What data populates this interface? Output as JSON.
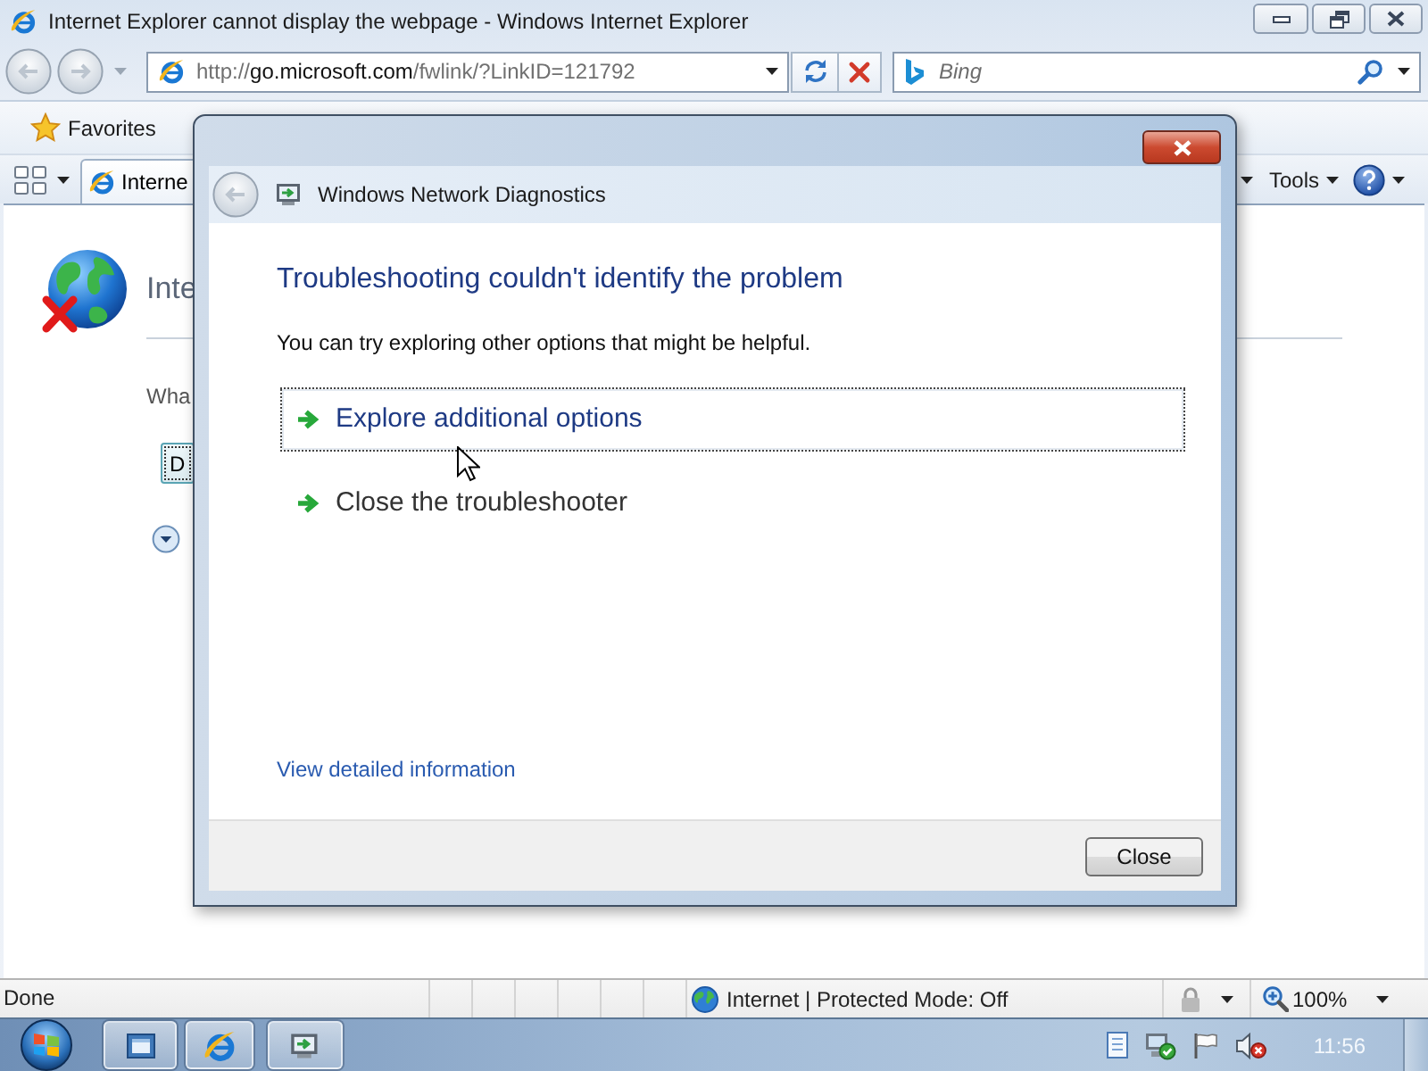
{
  "browser": {
    "title": "Internet Explorer cannot display the webpage - Windows Internet Explorer",
    "address": {
      "scheme": "http://",
      "domain": "go.microsoft.com",
      "path": "/fwlink/?LinkID=121792"
    },
    "search": {
      "placeholder": "Bing"
    }
  },
  "favorites_bar": {
    "label": "Favorites"
  },
  "command_bar": {
    "tabs": [
      {
        "label": "Interne",
        "selected": true
      }
    ],
    "menus": [
      {
        "label": "Tools"
      }
    ]
  },
  "page": {
    "heading": "Inte",
    "text": "Wha",
    "button": "D"
  },
  "dialog": {
    "title": "Windows Network Diagnostics",
    "heading": "Troubleshooting couldn't identify the problem",
    "message": "You can try exploring other options that might be helpful.",
    "options": [
      {
        "label": "Explore additional options",
        "selected": true
      },
      {
        "label": "Close the troubleshooter",
        "selected": false
      }
    ],
    "link": "View detailed information",
    "buttons": [
      "Close"
    ]
  },
  "status_bar": {
    "text": "Done",
    "zone": "Internet | Protected Mode: Off",
    "zoom": "100%"
  },
  "taskbar": {
    "clock": "11:56"
  }
}
